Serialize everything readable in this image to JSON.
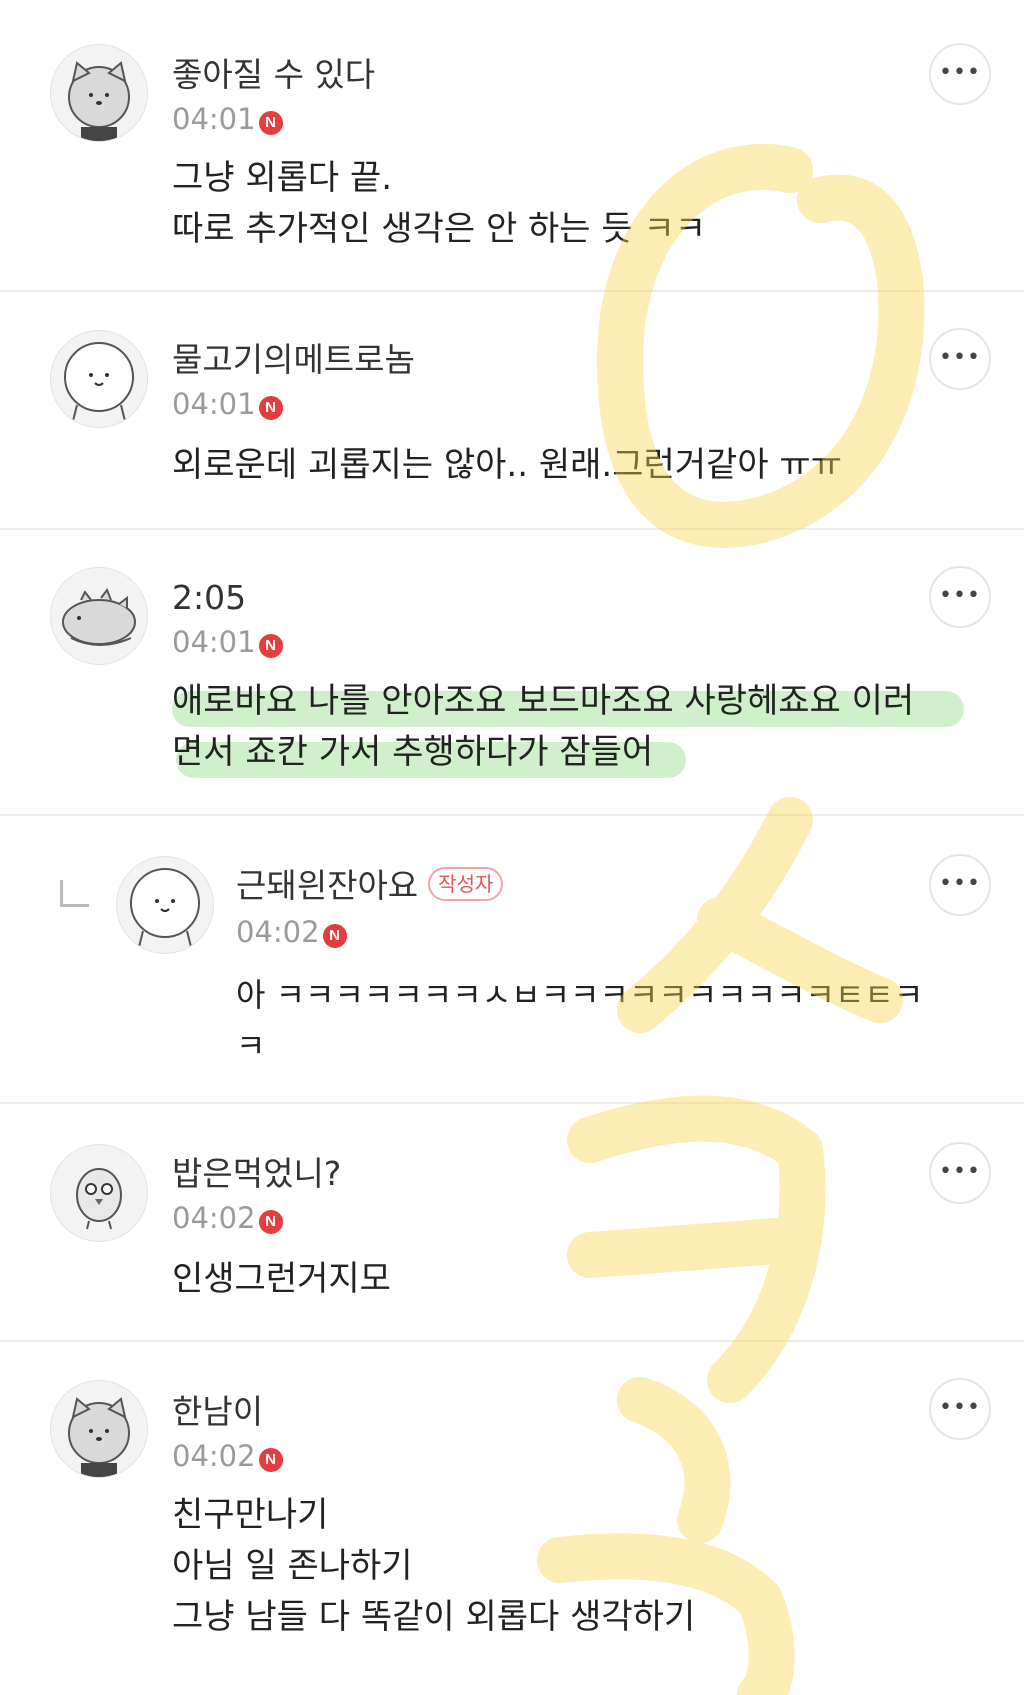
{
  "comments": [
    {
      "author": "좋아질 수 있다",
      "time": "04:01",
      "badge": "N",
      "avatar_icon": "cat-avatar-icon",
      "lines": "그냥 외롭다 끝.\n따로 추가적인 생각은 안 하는 듯 ㅋㅋ"
    },
    {
      "author": "물고기의메트로놈",
      "time": "04:01",
      "badge": "N",
      "avatar_icon": "blob-avatar-icon",
      "lines": "외로운데 괴롭지는 않아.. 원래.그런거같아 ㅠㅠ"
    },
    {
      "author": "2:05",
      "time": "04:01",
      "badge": "N",
      "avatar_icon": "dino-avatar-icon",
      "lines": "애로바요 나를 안아조요 보드마조요 사랑헤죠요 이러\n면서 죠칸 가서 추행하다가 잠들어"
    },
    {
      "author": "근돼읜잔아요",
      "writer_tag": "작성자",
      "time": "04:02",
      "badge": "N",
      "avatar_icon": "blob-avatar-icon",
      "lines": "아 ㅋㅋㅋㅋㅋㅋㅋㅅㅂㅋㅋㅋㅋㅋㅋㅋㅋㅋㅋㅌㅌㅋ\nㅋ"
    },
    {
      "author": "밥은먹었니?",
      "time": "04:02",
      "badge": "N",
      "avatar_icon": "bird-avatar-icon",
      "lines": "인생그런거지모"
    },
    {
      "author": "한남이",
      "time": "04:02",
      "badge": "N",
      "avatar_icon": "cat-avatar-icon",
      "lines": "친구만나기\n아님 일 존나하기\n그냥 남들 다 똑같이 외롭다 생각하기"
    }
  ],
  "more_label": "•••",
  "colors": {
    "badge": "#e33d3d",
    "highlight_yellow": "#f5d54a",
    "highlight_green": "#9bd98f",
    "divider": "#ececec"
  }
}
